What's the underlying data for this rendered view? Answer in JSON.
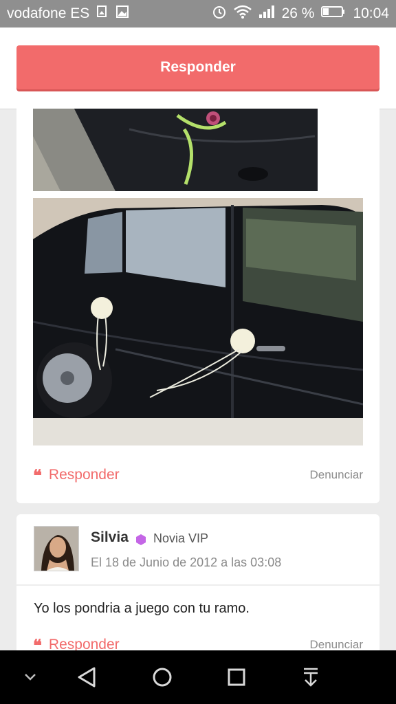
{
  "status_bar": {
    "carrier": "vodafone ES",
    "battery": "26 %",
    "time": "10:04",
    "icons": [
      "image-icon",
      "gallery-icon",
      "alarm-icon",
      "wifi-icon",
      "signal-icon",
      "battery-icon"
    ]
  },
  "header": {
    "reply_button": "Responder"
  },
  "post1": {
    "reply_label": "Responder",
    "report_label": "Denunciar",
    "photos": [
      "car-door-pink-bow-photo",
      "black-car-white-bows-photo"
    ]
  },
  "post2": {
    "author": "Silvia",
    "badge": "Novia VIP",
    "date": "El 18 de Junio de 2012 a las 03:08",
    "comment": "Yo los pondria a juego con tu ramo.",
    "reply_label": "Responder",
    "report_label": "Denunciar"
  },
  "colors": {
    "accent": "#f26b6b",
    "vip": "#c466e6",
    "statusbar": "#8f8f8f"
  },
  "nav": {
    "icons": [
      "chevron-down-icon",
      "back-icon",
      "home-icon",
      "recents-icon",
      "download-icon"
    ]
  }
}
